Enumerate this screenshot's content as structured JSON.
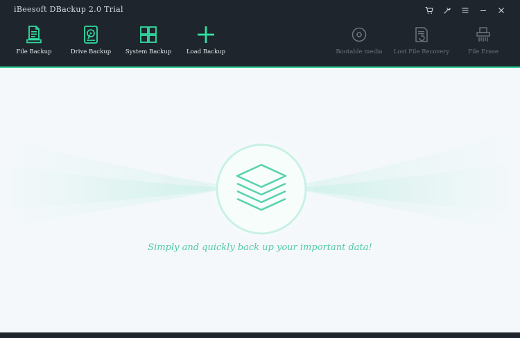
{
  "window": {
    "title": "iBeesoft DBackup 2.0 Trial"
  },
  "controls": {
    "cart": "cart-icon",
    "settings": "wrench-icon",
    "menu": "menu-icon",
    "minimize": "minimize-icon",
    "close": "close-icon"
  },
  "toolbar": {
    "file_backup": "File Backup",
    "drive_backup": "Drive Backup",
    "system_backup": "System Backup",
    "load_backup": "Load Backup",
    "bootable_media": "Bootable media",
    "lost_file_recovery": "Lost File Recovery",
    "file_erase": "File Erase"
  },
  "main": {
    "tagline": "Simply and quickly back up your important data!"
  },
  "colors": {
    "accent": "#2fd39a",
    "header_bg": "#1f252c",
    "tagline": "#52c9a4",
    "disabled": "#6b7580"
  }
}
